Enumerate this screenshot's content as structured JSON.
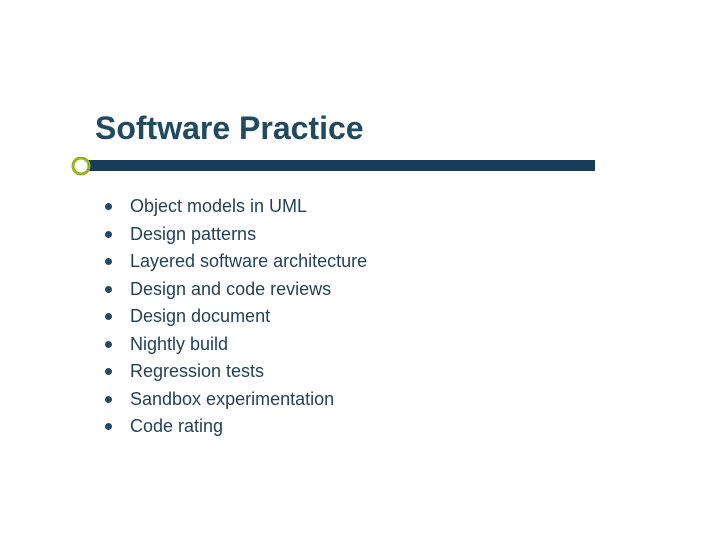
{
  "title": "Software Practice",
  "colors": {
    "text": "#1f4a60",
    "accent_bar": "#173d59",
    "accent_ring": "#93b51b"
  },
  "bullets": [
    "Object models in UML",
    "Design patterns",
    "Layered software architecture",
    "Design and code reviews",
    "Design document",
    "Nightly build",
    "Regression tests",
    "Sandbox experimentation",
    "Code rating"
  ]
}
